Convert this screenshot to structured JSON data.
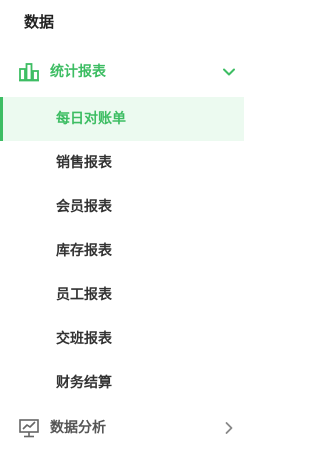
{
  "section": {
    "title": "数据"
  },
  "group_stats": {
    "label": "统计报表",
    "icon": "bar-chart-icon",
    "expanded": true,
    "color": "#3dbd63",
    "items": [
      {
        "label": "每日对账单",
        "active": true
      },
      {
        "label": "销售报表",
        "active": false
      },
      {
        "label": "会员报表",
        "active": false
      },
      {
        "label": "库存报表",
        "active": false
      },
      {
        "label": "员工报表",
        "active": false
      },
      {
        "label": "交班报表",
        "active": false
      },
      {
        "label": "财务结算",
        "active": false
      }
    ]
  },
  "group_analysis": {
    "label": "数据分析",
    "icon": "monitor-chart-icon",
    "expanded": false
  }
}
